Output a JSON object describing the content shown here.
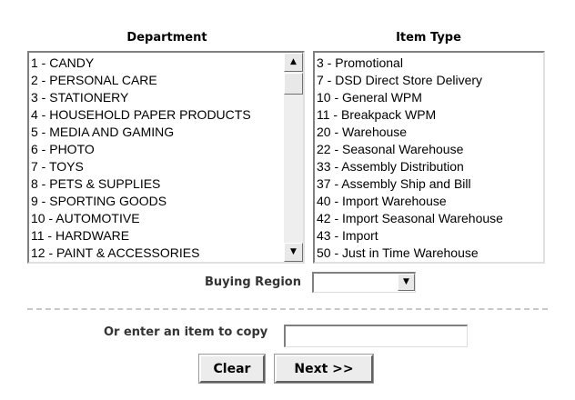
{
  "department": {
    "header": "Department",
    "options": [
      "1 - CANDY",
      "2 - PERSONAL CARE",
      "3 - STATIONERY",
      "4 - HOUSEHOLD PAPER PRODUCTS",
      "5 - MEDIA AND GAMING",
      "6 - PHOTO",
      "7 - TOYS",
      "8 - PETS & SUPPLIES",
      "9 - SPORTING GOODS",
      "10 - AUTOMOTIVE",
      "11 - HARDWARE",
      "12 - PAINT & ACCESSORIES"
    ]
  },
  "item_type": {
    "header": "Item Type",
    "options": [
      "3 - Promotional",
      "7 - DSD Direct Store Delivery",
      "10 - General WPM",
      "11 - Breakpack WPM",
      "20 - Warehouse",
      "22 - Seasonal Warehouse",
      "33 - Assembly Distribution",
      "37 - Assembly Ship and Bill",
      "40 - Import Warehouse",
      "42 - Import Seasonal Warehouse",
      "43 - Import",
      "50 - Just in Time Warehouse"
    ]
  },
  "buying_region": {
    "label": "Buying Region",
    "selected": ""
  },
  "copy_item": {
    "label": "Or enter an item to copy",
    "value": ""
  },
  "buttons": {
    "clear": "Clear",
    "next": "Next >>"
  },
  "icons": {
    "scroll_up": "scroll-up-arrow-icon",
    "scroll_down": "scroll-down-arrow-icon",
    "dropdown": "dropdown-arrow-icon"
  }
}
